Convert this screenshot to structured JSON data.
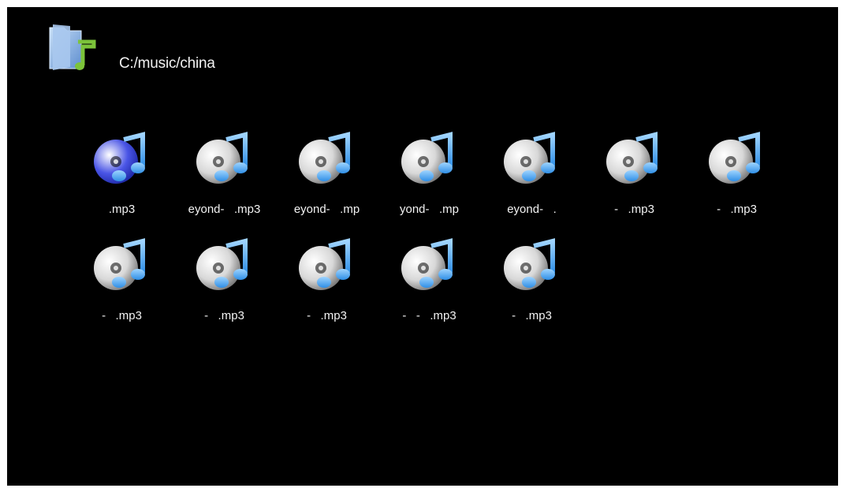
{
  "header": {
    "path": "C:/music/china",
    "folder_icon": "music-folder-icon"
  },
  "theme": {
    "background": "#000000",
    "text": "#f2f2f2",
    "disc_silver": "#d8d8d8",
    "disc_selected": "#4a55e6",
    "note_blue": "#2f8fe6",
    "folder_blue": "#8ab4e4",
    "folder_green": "#7cc43a"
  },
  "files": [
    {
      "name": ".mp3",
      "icon": "music-disc-icon",
      "selected": true
    },
    {
      "name": "eyond-   .mp3",
      "icon": "music-disc-icon",
      "selected": false
    },
    {
      "name": "eyond-   .mp",
      "icon": "music-disc-icon",
      "selected": false
    },
    {
      "name": "yond-   .mp",
      "icon": "music-disc-icon",
      "selected": false
    },
    {
      "name": "eyond-   .",
      "icon": "music-disc-icon",
      "selected": false
    },
    {
      "name": "-   .mp3",
      "icon": "music-disc-icon",
      "selected": false
    },
    {
      "name": "-   .mp3",
      "icon": "music-disc-icon",
      "selected": false
    },
    {
      "name": "-   .mp3",
      "icon": "music-disc-icon",
      "selected": false
    },
    {
      "name": "-   .mp3",
      "icon": "music-disc-icon",
      "selected": false
    },
    {
      "name": "-   .mp3",
      "icon": "music-disc-icon",
      "selected": false
    },
    {
      "name": "-   -   .mp3",
      "icon": "music-disc-icon",
      "selected": false
    },
    {
      "name": "-   .mp3",
      "icon": "music-disc-icon",
      "selected": false
    }
  ]
}
